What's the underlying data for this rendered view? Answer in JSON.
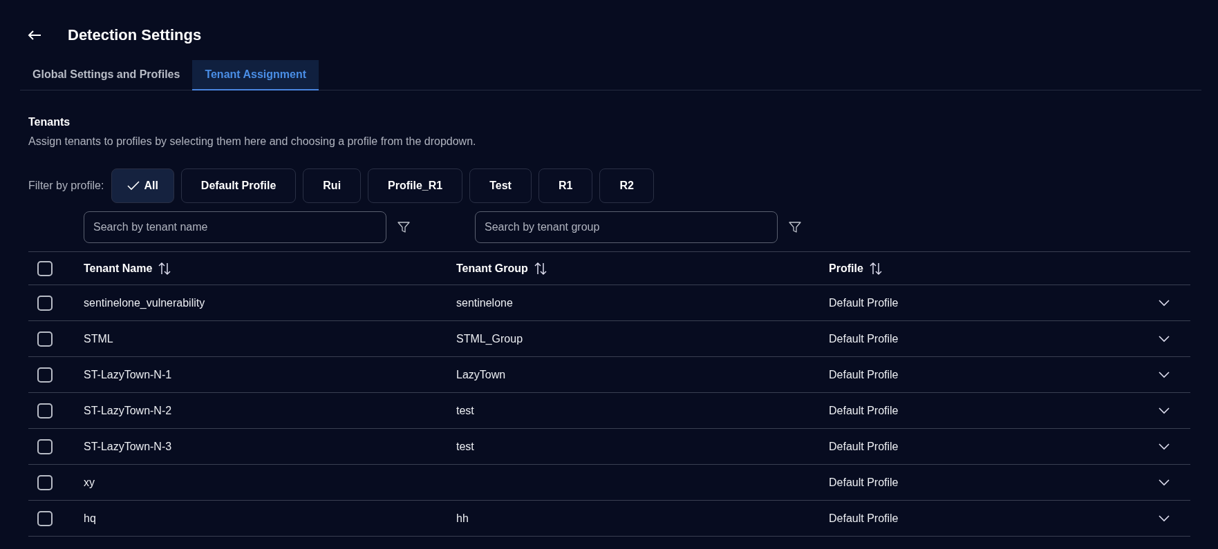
{
  "header": {
    "title": "Detection Settings"
  },
  "tabs": [
    {
      "label": "Global Settings and Profiles",
      "selected": false
    },
    {
      "label": "Tenant Assignment",
      "selected": true
    }
  ],
  "section": {
    "title": "Tenants",
    "description": "Assign tenants to profiles by selecting them here and choosing a profile from the dropdown."
  },
  "filter": {
    "label": "Filter by profile:",
    "chips": [
      {
        "label": "All",
        "selected": true
      },
      {
        "label": "Default Profile",
        "selected": false
      },
      {
        "label": "Rui",
        "selected": false
      },
      {
        "label": "Profile_R1",
        "selected": false
      },
      {
        "label": "Test",
        "selected": false
      },
      {
        "label": "R1",
        "selected": false
      },
      {
        "label": "R2",
        "selected": false
      }
    ]
  },
  "search": [
    {
      "placeholder": "Search by tenant name"
    },
    {
      "placeholder": "Search by tenant group"
    }
  ],
  "table": {
    "select_all_checked": false,
    "columns": [
      "Tenant Name",
      "Tenant Group",
      "Profile"
    ],
    "rows": [
      {
        "checked": false,
        "name": "sentinelone_vulnerability",
        "group": "sentinelone",
        "profile": "Default Profile"
      },
      {
        "checked": false,
        "name": "STML",
        "group": "STML_Group",
        "profile": "Default Profile"
      },
      {
        "checked": false,
        "name": "ST-LazyTown-N-1",
        "group": "LazyTown",
        "profile": "Default Profile"
      },
      {
        "checked": false,
        "name": "ST-LazyTown-N-2",
        "group": "test",
        "profile": "Default Profile"
      },
      {
        "checked": false,
        "name": "ST-LazyTown-N-3",
        "group": "test",
        "profile": "Default Profile"
      },
      {
        "checked": false,
        "name": "xy",
        "group": "",
        "profile": "Default Profile"
      },
      {
        "checked": false,
        "name": "hq",
        "group": "hh",
        "profile": "Default Profile"
      }
    ]
  }
}
